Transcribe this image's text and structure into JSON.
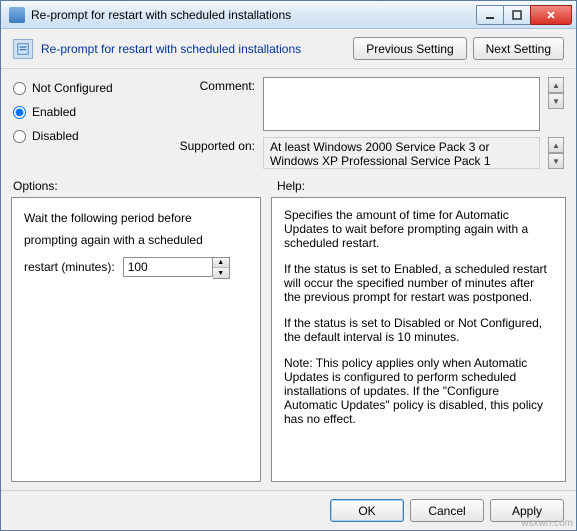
{
  "titlebar": {
    "text": "Re-prompt for restart with scheduled installations"
  },
  "header": {
    "title": "Re-prompt for restart with scheduled installations",
    "prev_btn": "Previous Setting",
    "next_btn": "Next Setting"
  },
  "radios": {
    "not_configured": "Not Configured",
    "enabled": "Enabled",
    "disabled": "Disabled",
    "selected": "enabled"
  },
  "comment": {
    "label": "Comment:",
    "value": ""
  },
  "supported": {
    "label": "Supported on:",
    "value": "At least Windows 2000 Service Pack 3 or Windows XP Professional Service Pack 1"
  },
  "labels": {
    "options": "Options:",
    "help": "Help:"
  },
  "options": {
    "line1": "Wait the following period before",
    "line2": "prompting again with a scheduled",
    "spinner_label": "restart (minutes):",
    "spinner_value": "100"
  },
  "help": {
    "p1": "Specifies the amount of time for Automatic Updates to wait before prompting again with a scheduled restart.",
    "p2": "If the status is set to Enabled, a scheduled restart will occur the specified number of minutes after the previous prompt for restart was postponed.",
    "p3": "If the status is set to Disabled or Not Configured, the default interval is 10 minutes.",
    "p4": "Note: This policy applies only when Automatic Updates is configured to perform scheduled installations of updates. If the \"Configure Automatic Updates\" policy is disabled, this policy has no effect."
  },
  "footer": {
    "ok": "OK",
    "cancel": "Cancel",
    "apply": "Apply"
  },
  "watermark": "wsxwn.com"
}
